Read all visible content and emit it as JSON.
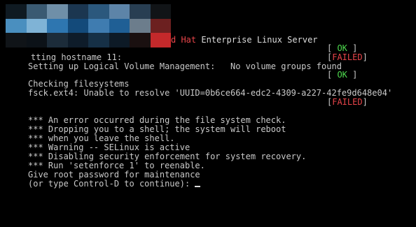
{
  "header": {
    "brand_fragment": "d Hat",
    "product": " Enterprise Linux Server"
  },
  "boot": {
    "ok_1": {
      "open": "[ ",
      "status": "OK",
      "close": " ]"
    },
    "hostname": {
      "text": "tting hostname 11:",
      "open": "[",
      "status": "FAILED",
      "close": "]"
    },
    "lvm": {
      "text": "Setting up Logical Volume Management:   No volume groups found"
    },
    "ok_2": {
      "open": "[ ",
      "status": "OK",
      "close": " ]"
    },
    "checking": "Checking filesystems",
    "fsck": "fsck.ext4: Unable to resolve 'UUID=0b6ce664-edc2-4309-a227-42fe9d648e04'",
    "fsck_status": {
      "open": "[",
      "status": "FAILED",
      "close": "]"
    }
  },
  "messages": [
    "*** An error occurred during the file system check.",
    "*** Dropping you to a shell; the system will reboot",
    "*** when you leave the shell.",
    "*** Warning -- SELinux is active",
    "*** Disabling security enforcement for system recovery.",
    "*** Run 'setenforce 1' to reenable.",
    "Give root password for maintenance",
    "(or type Control-D to continue): "
  ],
  "colors": {
    "background": "#000000",
    "text": "#c9c9c9",
    "failed": "#e8454a",
    "ok": "#4fdc4f"
  },
  "mosaic_colors": [
    "#0f1a22",
    "#3a5a72",
    "#6f8fa8",
    "#1b3650",
    "#2b587d",
    "#5d84a8",
    "#283e52",
    "#111417",
    "#4a8fbf",
    "#7fb3d6",
    "#2e76b0",
    "#134a7a",
    "#3f7cb0",
    "#1f5f95",
    "#6c7d8c",
    "#6c2020",
    "#101418",
    "#0c1218",
    "#1c2c3a",
    "#0e1c2a",
    "#163046",
    "#0d1a26",
    "#1a1010",
    "#c4292b"
  ]
}
